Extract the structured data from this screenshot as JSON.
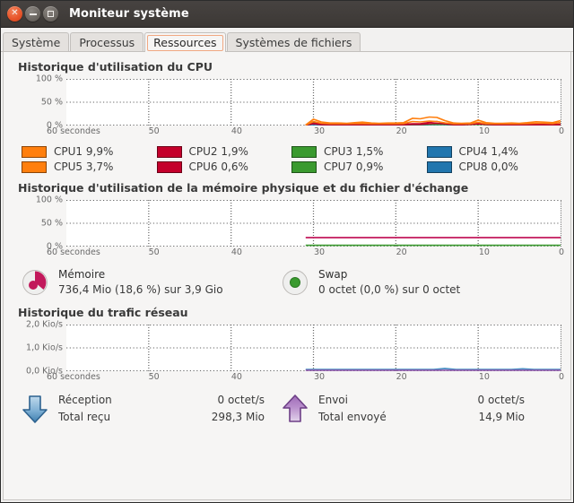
{
  "window": {
    "title": "Moniteur système",
    "controls": [
      {
        "name": "close-button",
        "glyph": "✕"
      },
      {
        "name": "minimize-button",
        "glyph": "—"
      },
      {
        "name": "maximize-button",
        "glyph": "▫"
      }
    ]
  },
  "tabs": [
    {
      "label": "Système",
      "active": false
    },
    {
      "label": "Processus",
      "active": false
    },
    {
      "label": "Ressources",
      "active": true
    },
    {
      "label": "Systèmes de fichiers",
      "active": false
    }
  ],
  "cpu": {
    "title": "Historique d'utilisation du CPU",
    "legend": [
      {
        "name": "CPU1",
        "value": "9,9%",
        "color": "#ff7f0e"
      },
      {
        "name": "CPU2",
        "value": "1,9%",
        "color": "#c4002b"
      },
      {
        "name": "CPU3",
        "value": "1,5%",
        "color": "#3a9a2f"
      },
      {
        "name": "CPU4",
        "value": "1,4%",
        "color": "#2176ae"
      },
      {
        "name": "CPU5",
        "value": "3,7%",
        "color": "#ff7f0e"
      },
      {
        "name": "CPU6",
        "value": "0,6%",
        "color": "#c4002b"
      },
      {
        "name": "CPU7",
        "value": "0,9%",
        "color": "#3a9a2f"
      },
      {
        "name": "CPU8",
        "value": "0,0%",
        "color": "#2176ae"
      }
    ]
  },
  "memory": {
    "title": "Historique d'utilisation de la mémoire physique et du fichier d'échange",
    "items": [
      {
        "icon": "memory-pie-icon",
        "name": "Mémoire",
        "value": "736,4 Mio (18,6 %) sur 3,9 Gio",
        "color": "#c2185b"
      },
      {
        "icon": "swap-dot-icon",
        "name": "Swap",
        "value": "0 octet (0,0 %) sur 0 octet",
        "color": "#3a9a2f"
      }
    ]
  },
  "network": {
    "title": "Historique du trafic réseau",
    "items": [
      {
        "icon": "download-arrow-icon",
        "rate_label": "Réception",
        "rate_value": "0 octet/s",
        "total_label": "Total reçu",
        "total_value": "298,3 Mio",
        "color": "#4a90c4"
      },
      {
        "icon": "upload-arrow-icon",
        "rate_label": "Envoi",
        "rate_value": "0 octet/s",
        "total_label": "Total envoyé",
        "total_value": "14,9 Mio",
        "color": "#8e53a8"
      }
    ]
  },
  "chart_data": [
    {
      "id": "cpu-history",
      "type": "line",
      "title": "Historique d'utilisation du CPU",
      "xlabel": "",
      "ylabel": "",
      "ylim": [
        0,
        100
      ],
      "yticks": [
        0,
        50,
        100
      ],
      "ytick_labels": [
        "0 %",
        "50 %",
        "100 %"
      ],
      "xlim": [
        60,
        0
      ],
      "xticks": [
        60,
        50,
        40,
        30,
        20,
        10,
        0
      ],
      "xtick_labels": [
        "60 secondes",
        "50",
        "40",
        "30",
        "20",
        "10",
        "0"
      ],
      "grid": true,
      "legend_position": "below",
      "x": [
        31,
        30,
        29,
        28,
        27,
        26,
        25,
        24,
        23,
        22,
        21,
        20,
        19,
        18,
        17,
        16,
        15,
        14,
        13,
        12,
        11,
        10,
        9,
        8,
        7,
        6,
        5,
        4,
        3,
        2,
        1,
        0
      ],
      "series": [
        {
          "name": "CPU1",
          "color": "#ff7f0e",
          "values": [
            0,
            7,
            4,
            3,
            3,
            2,
            4,
            5,
            3,
            2,
            3,
            3,
            4,
            12,
            11,
            15,
            14,
            9,
            4,
            3,
            4,
            9,
            5,
            3,
            3,
            4,
            3,
            5,
            7,
            6,
            5,
            10
          ]
        },
        {
          "name": "CPU2",
          "color": "#c4002b",
          "values": [
            0,
            4,
            3,
            2,
            2,
            2,
            2,
            2,
            2,
            2,
            2,
            2,
            2,
            3,
            3,
            6,
            8,
            4,
            2,
            2,
            3,
            5,
            3,
            2,
            3,
            3,
            3,
            3,
            3,
            3,
            2,
            2
          ]
        },
        {
          "name": "CPU3",
          "color": "#3a9a2f",
          "values": [
            0,
            6,
            3,
            2,
            2,
            2,
            2,
            2,
            2,
            2,
            2,
            2,
            2,
            2,
            2,
            3,
            3,
            3,
            2,
            2,
            2,
            3,
            2,
            2,
            2,
            2,
            2,
            2,
            2,
            2,
            2,
            2
          ]
        },
        {
          "name": "CPU4",
          "color": "#2176ae",
          "values": [
            0,
            3,
            2,
            1,
            1,
            1,
            1,
            1,
            1,
            1,
            1,
            1,
            1,
            1,
            1,
            2,
            2,
            2,
            1,
            1,
            3,
            4,
            2,
            1,
            1,
            1,
            1,
            1,
            1,
            1,
            1,
            1
          ]
        },
        {
          "name": "CPU5",
          "color": "#ff7f0e",
          "values": [
            0,
            5,
            3,
            2,
            2,
            2,
            3,
            3,
            2,
            2,
            2,
            2,
            3,
            8,
            7,
            9,
            8,
            5,
            3,
            2,
            3,
            6,
            3,
            2,
            2,
            3,
            2,
            3,
            4,
            4,
            3,
            6
          ]
        },
        {
          "name": "CPU6",
          "color": "#c4002b",
          "values": [
            0,
            3,
            2,
            1,
            1,
            1,
            1,
            1,
            1,
            1,
            1,
            1,
            1,
            2,
            2,
            3,
            4,
            3,
            1,
            1,
            2,
            3,
            2,
            1,
            2,
            2,
            2,
            2,
            2,
            2,
            1,
            1
          ]
        },
        {
          "name": "CPU7",
          "color": "#3a9a2f",
          "values": [
            0,
            4,
            2,
            1,
            1,
            1,
            1,
            1,
            1,
            1,
            1,
            1,
            1,
            1,
            1,
            2,
            2,
            2,
            1,
            1,
            1,
            2,
            1,
            1,
            1,
            1,
            1,
            1,
            1,
            1,
            1,
            1
          ]
        },
        {
          "name": "CPU8",
          "color": "#2176ae",
          "values": [
            0,
            2,
            1,
            1,
            1,
            1,
            1,
            1,
            1,
            1,
            1,
            1,
            1,
            1,
            1,
            1,
            1,
            1,
            1,
            1,
            2,
            3,
            1,
            1,
            1,
            1,
            1,
            1,
            1,
            1,
            1,
            1
          ]
        }
      ]
    },
    {
      "id": "memory-history",
      "type": "line",
      "title": "Historique d'utilisation de la mémoire physique et du fichier d'échange",
      "ylim": [
        0,
        100
      ],
      "yticks": [
        0,
        50,
        100
      ],
      "ytick_labels": [
        "0 %",
        "50 %",
        "100 %"
      ],
      "xlim": [
        60,
        0
      ],
      "xticks": [
        60,
        50,
        40,
        30,
        20,
        10,
        0
      ],
      "xtick_labels": [
        "60 secondes",
        "50",
        "40",
        "30",
        "20",
        "10",
        "0"
      ],
      "grid": true,
      "series": [
        {
          "name": "Mémoire",
          "color": "#c2185b",
          "constant_value": 18.6,
          "start_x": 31
        },
        {
          "name": "Swap",
          "color": "#3a9a2f",
          "constant_value": 0.0,
          "start_x": 31
        }
      ]
    },
    {
      "id": "network-history",
      "type": "line",
      "title": "Historique du trafic réseau",
      "ylim": [
        0,
        2
      ],
      "yticks": [
        0,
        1,
        2
      ],
      "ytick_labels": [
        "0,0 Kio/s",
        "1,0 Kio/s",
        "2,0 Kio/s"
      ],
      "xlim": [
        60,
        0
      ],
      "xticks": [
        60,
        50,
        40,
        30,
        20,
        10,
        0
      ],
      "xtick_labels": [
        "60 secondes",
        "50",
        "40",
        "30",
        "20",
        "10",
        "0"
      ],
      "grid": true,
      "series": [
        {
          "name": "Réception",
          "color": "#4a90c4",
          "constant_value": 0.0,
          "start_x": 31
        },
        {
          "name": "Envoi",
          "color": "#8e53a8",
          "constant_value": 0.0,
          "start_x": 31
        }
      ]
    }
  ]
}
